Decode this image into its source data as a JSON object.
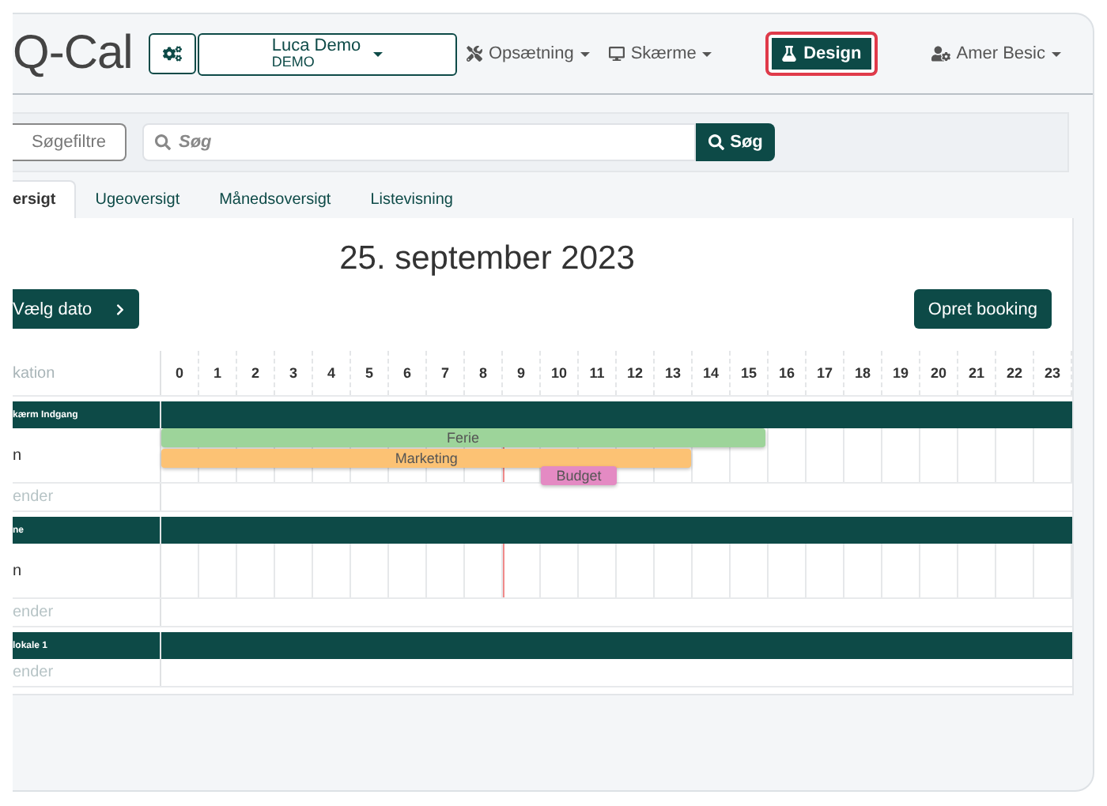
{
  "header": {
    "logo": "Q-Cal",
    "account": {
      "name": "Luca Demo",
      "sub": "DEMO"
    },
    "menus": [
      {
        "kind": "setup",
        "label": "Opsætning"
      },
      {
        "kind": "screens",
        "label": "Skærme"
      }
    ],
    "design_button": {
      "label": "Design",
      "highlighted": true
    },
    "user": {
      "name": "Amer Besic"
    }
  },
  "search": {
    "filters_button": "Søgefiltre",
    "placeholder": "Søg",
    "button": "Søg"
  },
  "tabs": [
    {
      "label": "ersigt",
      "selected": true
    },
    {
      "label": "Ugeoversigt",
      "selected": false
    },
    {
      "label": "Månedsoversigt",
      "selected": false
    },
    {
      "label": "Listevisning",
      "selected": false
    }
  ],
  "calendar": {
    "date_title": "25. september 2023",
    "pick_date_button": "Vælg dato",
    "create_button": "Opret booking",
    "location_header": "kation",
    "now_marker": {
      "level": 0.375
    },
    "hours": [
      "0",
      "1",
      "2",
      "3",
      "4",
      "5",
      "6",
      "7",
      "8",
      "9",
      "10",
      "11",
      "12",
      "13",
      "14",
      "15",
      "16",
      "17",
      "18",
      "19",
      "20",
      "21",
      "22",
      "23"
    ],
    "groups": [
      {
        "name": "kærm Indgang",
        "rows": [
          {
            "kind": "resource",
            "label": "n",
            "events": [
              {
                "title": "Ferie",
                "end": {
                  "level": 0.6625
                },
                "color": "#9dd49a"
              },
              {
                "title": "Marketing",
                "end": {
                  "level": 0.582
                },
                "color": "#fcc274"
              },
              {
                "title": "Budget",
                "start": {
                  "level": 0.4167
                },
                "end": {
                  "level": 0.5
                },
                "color": "#e48ac3"
              }
            ]
          },
          {
            "kind": "calendar",
            "label": "ender"
          }
        ]
      },
      {
        "name": "ne",
        "rows": [
          {
            "kind": "resource",
            "label": "n",
            "events": []
          },
          {
            "kind": "calendar",
            "label": "ender"
          }
        ]
      },
      {
        "name": "lokale 1",
        "rows": [
          {
            "kind": "calendar",
            "label": "ender"
          }
        ]
      }
    ]
  }
}
